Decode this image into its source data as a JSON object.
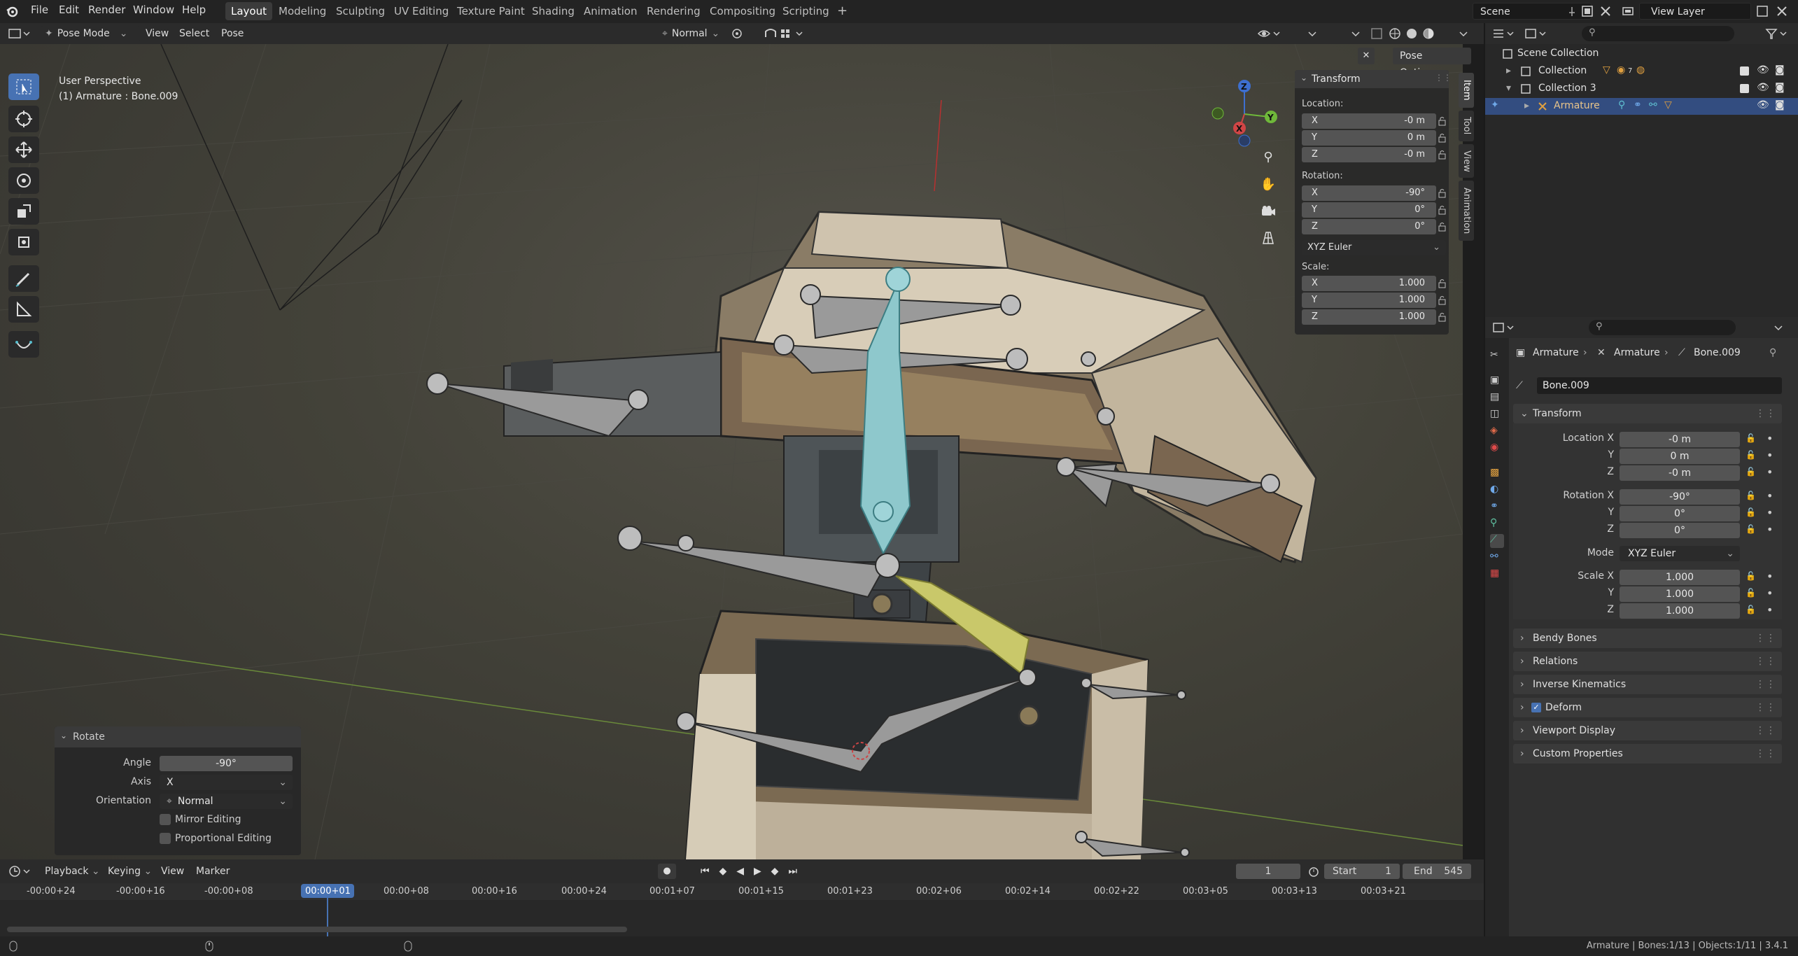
{
  "topbar": {
    "menus": [
      "File",
      "Edit",
      "Render",
      "Window",
      "Help"
    ],
    "workspaces": [
      "Layout",
      "Modeling",
      "Sculpting",
      "UV Editing",
      "Texture Paint",
      "Shading",
      "Animation",
      "Rendering",
      "Compositing",
      "Scripting"
    ],
    "active_workspace": "Layout",
    "add_tab": "+",
    "scene": "Scene",
    "view_layer": "View Layer"
  },
  "viewport_header": {
    "mode": "Pose Mode",
    "menus": [
      "View",
      "Select",
      "Pose"
    ],
    "orientation": "Normal",
    "pose_options": "Pose Options"
  },
  "viewport": {
    "perspective": "User Perspective",
    "active": "(1) Armature : Bone.009",
    "gizmo": {
      "x": "X",
      "y": "Y",
      "z": "Z"
    }
  },
  "npanel": {
    "title": "Transform",
    "location_label": "Location:",
    "rotation_label": "Rotation:",
    "scale_label": "Scale:",
    "location": [
      {
        "axis": "X",
        "value": "-0 m"
      },
      {
        "axis": "Y",
        "value": "0 m"
      },
      {
        "axis": "Z",
        "value": "-0 m"
      }
    ],
    "rotation": [
      {
        "axis": "X",
        "value": "-90°"
      },
      {
        "axis": "Y",
        "value": "0°"
      },
      {
        "axis": "Z",
        "value": "0°"
      }
    ],
    "rotation_mode": "XYZ Euler",
    "scale": [
      {
        "axis": "X",
        "value": "1.000"
      },
      {
        "axis": "Y",
        "value": "1.000"
      },
      {
        "axis": "Z",
        "value": "1.000"
      }
    ],
    "tabs": [
      "Item",
      "Tool",
      "View",
      "Animation"
    ]
  },
  "operator_panel": {
    "title": "Rotate",
    "angle_label": "Angle",
    "angle": "-90°",
    "axis_label": "Axis",
    "axis": "X",
    "orientation_label": "Orientation",
    "orientation": "Normal",
    "mirror": "Mirror Editing",
    "proportional": "Proportional Editing"
  },
  "timeline": {
    "menus": [
      "Playback",
      "Keying",
      "View",
      "Marker"
    ],
    "current_frame": "1",
    "start_label": "Start",
    "start": "1",
    "end_label": "End",
    "end": "545",
    "ticks": [
      "-00:00+24",
      "-00:00+16",
      "-00:00+08",
      "00:00+01",
      "00:00+08",
      "00:00+16",
      "00:00+24",
      "00:01+07",
      "00:01+15",
      "00:01+23",
      "00:02+06",
      "00:02+14",
      "00:02+22",
      "00:03+05",
      "00:03+13",
      "00:03+21"
    ],
    "playhead": "00:00+01"
  },
  "status": {
    "text": "Armature | Bones:1/13 | Objects:1/11 | 3.4.1"
  },
  "outliner": {
    "rows": [
      {
        "label": "Scene Collection"
      },
      {
        "label": "Collection",
        "badge": "7"
      },
      {
        "label": "Collection 3"
      },
      {
        "label": "Armature"
      }
    ]
  },
  "properties": {
    "breadcrumb": [
      "Armature",
      "Armature",
      "Bone.009"
    ],
    "bone_name": "Bone.009",
    "transform_title": "Transform",
    "location_x_label": "Location X",
    "rotation_x_label": "Rotation X",
    "scale_x_label": "Scale X",
    "y_label": "Y",
    "z_label": "Z",
    "location": [
      "-0 m",
      "0 m",
      "-0 m"
    ],
    "rotation": [
      "-90°",
      "0°",
      "0°"
    ],
    "mode_label": "Mode",
    "mode": "XYZ Euler",
    "scale": [
      "1.000",
      "1.000",
      "1.000"
    ],
    "panels": [
      "Bendy Bones",
      "Relations",
      "Inverse Kinematics",
      "Deform",
      "Viewport Display",
      "Custom Properties"
    ]
  },
  "colors": {
    "accent": "#4772b3",
    "selected_row": "#334d80",
    "active_bone": "#8ec8cc",
    "selected_bone": "#c9c86a"
  }
}
